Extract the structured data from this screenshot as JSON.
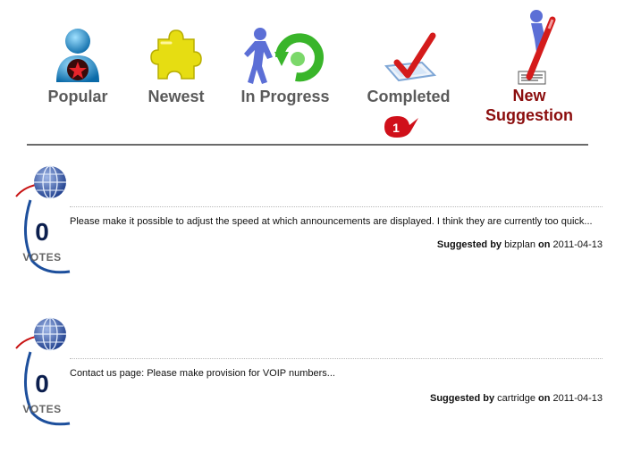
{
  "nav": {
    "popular": "Popular",
    "newest": "Newest",
    "in_progress": "In Progress",
    "completed": "Completed",
    "completed_badge": "1",
    "new_line1": "New",
    "new_line2": "Suggestion"
  },
  "posts": [
    {
      "votes": "0",
      "votes_label": "VOTES",
      "text": "Please make it possible to adjust the speed at which announcements are displayed. I think they are currently too quick...",
      "suggested_by_label": "Suggested by",
      "author": "bizplan",
      "on_label": "on",
      "date": "2011-04-13"
    },
    {
      "votes": "0",
      "votes_label": "VOTES",
      "text": "Contact us page: Please make provision for VOIP numbers...",
      "suggested_by_label": "Suggested by",
      "author": "cartridge",
      "on_label": "on",
      "date": "2011-04-13"
    }
  ],
  "colors": {
    "label_gray": "#5a5a5a",
    "new_suggestion": "#8b0d0d",
    "vote_navy": "#0c1f4e",
    "badge_red": "#d0101a"
  },
  "icons": [
    "user-star-icon",
    "puzzle-icon",
    "refresh-person-icon",
    "checkmark-icon",
    "writing-person-icon",
    "globe-icon"
  ]
}
